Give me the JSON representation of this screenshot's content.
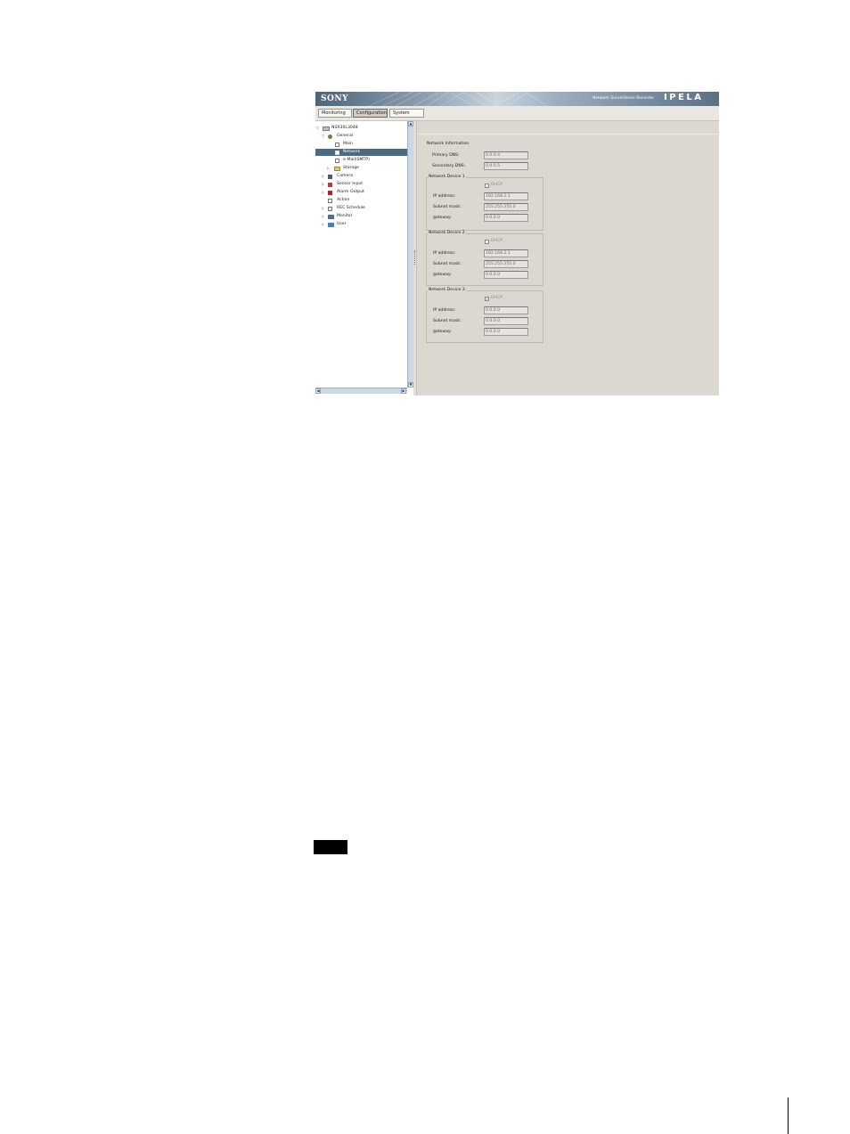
{
  "header": {
    "logo": "SONY",
    "product": "Network Surveillance Recorder",
    "brand": "IPELA"
  },
  "tabs": [
    {
      "label": "Monitoring",
      "active": false
    },
    {
      "label": "Configuration",
      "active": true
    },
    {
      "label": "System",
      "active": false
    }
  ],
  "tree": {
    "root": "NSR30L3048",
    "items": [
      {
        "label": "General",
        "expanded": true,
        "selected": false,
        "icon": "gear-icon"
      },
      {
        "label": "Main",
        "selected": false,
        "icon": "page-icon"
      },
      {
        "label": "Network",
        "selected": true,
        "icon": "page-icon"
      },
      {
        "label": "e-Mail(SMTP)",
        "selected": false,
        "icon": "page-icon"
      },
      {
        "label": "Storage",
        "selected": false,
        "icon": "folder-icon"
      },
      {
        "label": "Camera",
        "selected": false,
        "icon": "camera-icon"
      },
      {
        "label": "Sensor Input",
        "selected": false,
        "icon": "sensor-icon"
      },
      {
        "label": "Alarm Output",
        "selected": false,
        "icon": "alarm-icon"
      },
      {
        "label": "Action",
        "selected": false,
        "icon": "action-icon"
      },
      {
        "label": "REC Schedule",
        "selected": false,
        "icon": "calendar-icon"
      },
      {
        "label": "Monitor",
        "selected": false,
        "icon": "monitor-icon"
      },
      {
        "label": "User",
        "selected": false,
        "icon": "user-icon"
      }
    ]
  },
  "network_information": {
    "title": "Network Information",
    "primary_dns_label": "Primary DNS:",
    "primary_dns": "0.0.0.4",
    "secondary_dns_label": "Secondary DNS:",
    "secondary_dns": "0.0.0.5"
  },
  "devices": [
    {
      "title": "Network Device 1",
      "dhcp_label": "DHCP",
      "dhcp_checked": false,
      "ip_label": "IP address:",
      "ip": "192.168.1.1",
      "mask_label": "Subnet mask:",
      "mask": "255.255.255.0",
      "gateway_label": "gateway:",
      "gateway": "0.0.0.0"
    },
    {
      "title": "Network Device 2",
      "dhcp_label": "DHCP",
      "dhcp_checked": false,
      "ip_label": "IP address:",
      "ip": "192.168.2.1",
      "mask_label": "Subnet mask:",
      "mask": "255.255.255.0",
      "gateway_label": "gateway:",
      "gateway": "0.0.0.0"
    },
    {
      "title": "Network Device 3",
      "dhcp_label": "DHCP",
      "dhcp_checked": true,
      "ip_label": "IP address:",
      "ip": "0.0.0.0",
      "mask_label": "Subnet mask:",
      "mask": "0.0.0.0",
      "gateway_label": "gateway:",
      "gateway": "0.0.0.0"
    }
  ],
  "colors": {
    "selected_row": "#4d6a85",
    "content_bg": "#dcd8d1",
    "scrollbar": "#c9d8e7"
  }
}
